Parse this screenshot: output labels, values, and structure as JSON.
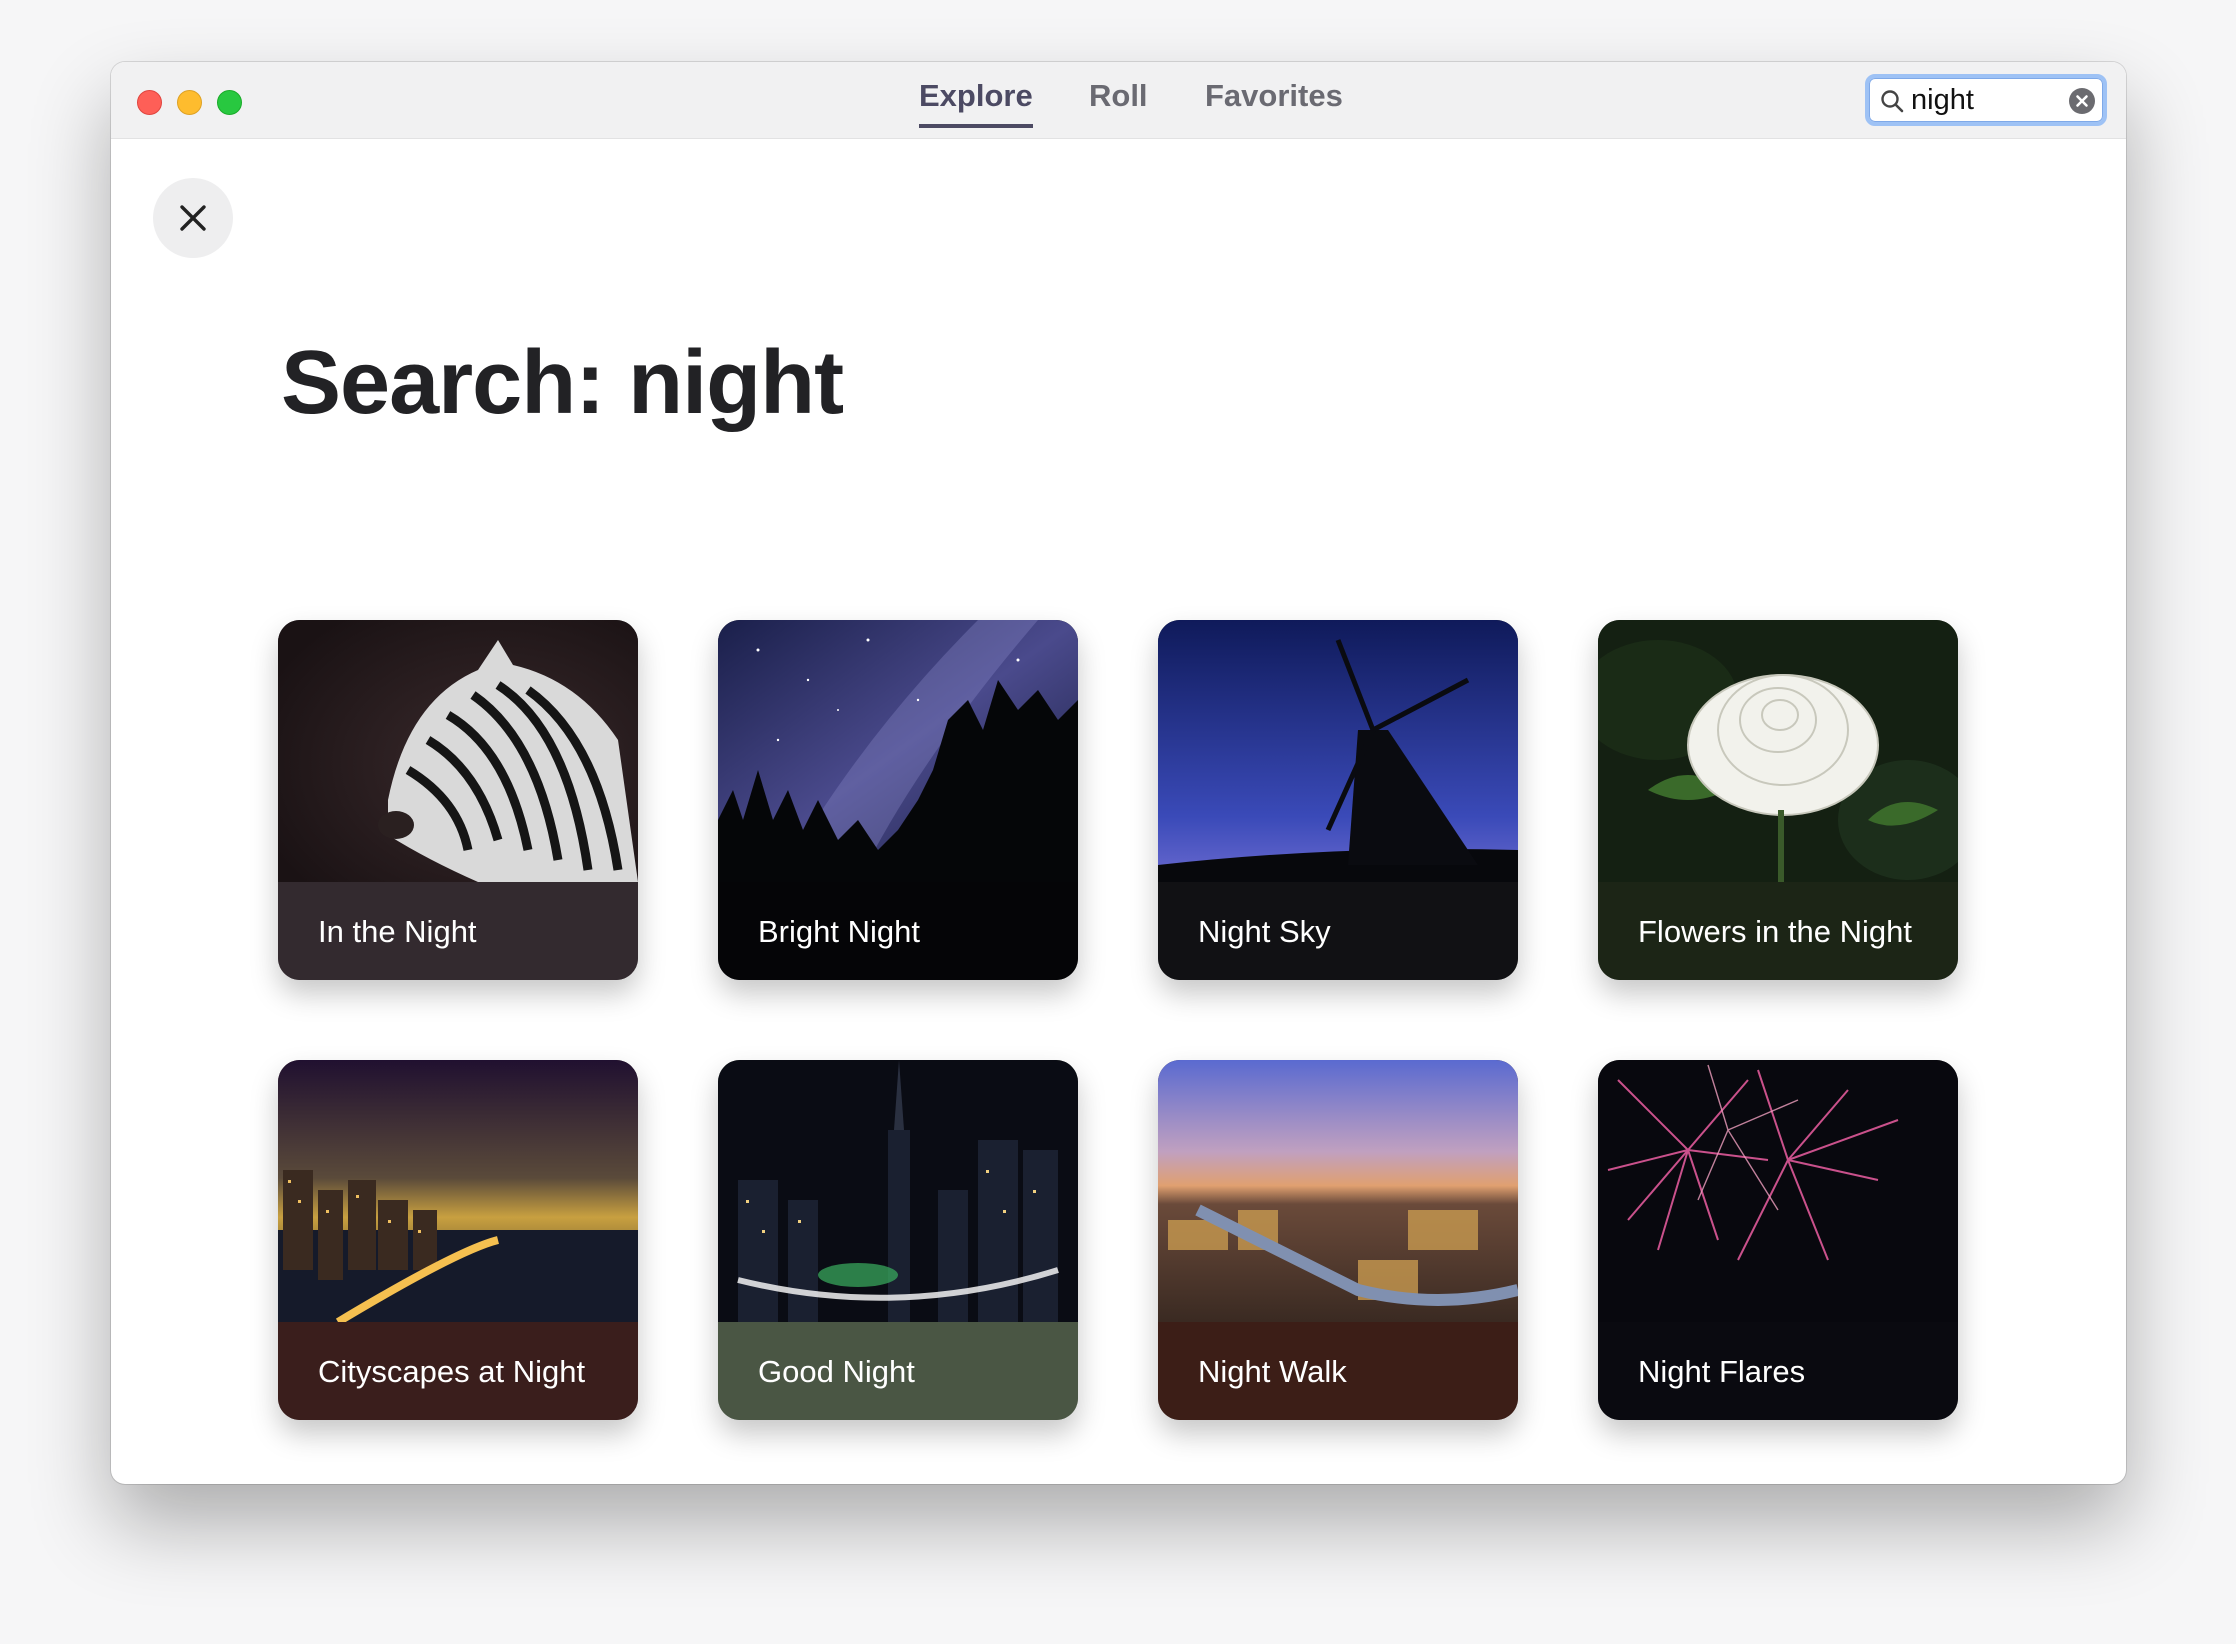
{
  "window": {
    "controls": [
      "close",
      "minimize",
      "zoom"
    ]
  },
  "nav": {
    "tabs": [
      {
        "label": "Explore",
        "active": true
      },
      {
        "label": "Roll",
        "active": false
      },
      {
        "label": "Favorites",
        "active": false
      }
    ]
  },
  "search": {
    "value": "night",
    "icon": "magnifier-icon",
    "clear_icon": "clear-circle-icon"
  },
  "close_button": {
    "icon": "close-x-icon"
  },
  "page": {
    "title": "Search: night"
  },
  "colors": {
    "accent": "#4c4a63",
    "search_focus": "#9ec2f5"
  },
  "results": [
    {
      "title": "In the Night",
      "bar_color": "#332a2f"
    },
    {
      "title": "Bright Night",
      "bar_color": "#050507"
    },
    {
      "title": "Night Sky",
      "bar_color": "#111114"
    },
    {
      "title": "Flowers in the Night",
      "bar_color": "#1c2516"
    },
    {
      "title": "Cityscapes at Night",
      "bar_color": "#3a1e1c"
    },
    {
      "title": "Good Night",
      "bar_color": "#4a5644"
    },
    {
      "title": "Night Walk",
      "bar_color": "#3c1e17"
    },
    {
      "title": "Night Flares",
      "bar_color": "#0a0a10"
    }
  ]
}
